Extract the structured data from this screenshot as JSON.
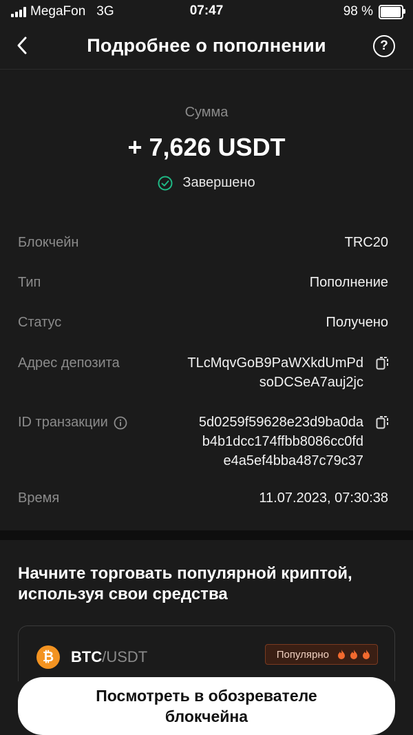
{
  "status_bar": {
    "carrier": "MegaFon",
    "network": "3G",
    "time": "07:47",
    "battery": "98 %"
  },
  "header": {
    "title": "Подробнее о пополнении",
    "help": "?"
  },
  "summary": {
    "amount_label": "Сумма",
    "amount": "+ 7,626 USDT",
    "status": "Завершено"
  },
  "details": {
    "blockchain_label": "Блокчейн",
    "blockchain_value": "TRC20",
    "type_label": "Тип",
    "type_value": "Пополнение",
    "status_label": "Статус",
    "status_value": "Получено",
    "address_label": "Адрес депозита",
    "address_line1": "TLcMqvGoB9PaWXkdUmPd",
    "address_line2": "soDCSeA7auj2jc",
    "txid_label": "ID транзакции",
    "txid_line1": "5d0259f59628e23d9ba0da",
    "txid_line2": "b4b1dcc174ffbb8086cc0fd",
    "txid_line3": "e4a5ef4bba487c79c37",
    "time_label": "Время",
    "time_value": "11.07.2023, 07:30:38"
  },
  "promo": {
    "title": "Начните торговать популярной криптой, используя свои средства",
    "pair_base": "BTC",
    "pair_quote": "/USDT",
    "badge": "Популярно",
    "coin_symbol": "₿"
  },
  "cta": {
    "label": "Посмотреть в обозревателе блокчейна"
  },
  "colors": {
    "background": "#1b1b1b",
    "success": "#1fb985",
    "muted": "#8b8b8b",
    "btc": "#f39321",
    "flame": "#f26a2e"
  }
}
